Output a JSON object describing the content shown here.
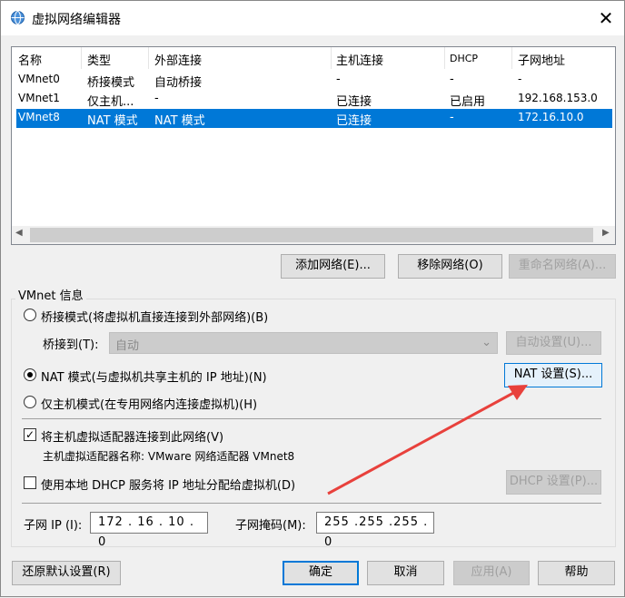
{
  "window": {
    "title": "虚拟网络编辑器",
    "close": "✕"
  },
  "table": {
    "headers": [
      "名称",
      "类型",
      "外部连接",
      "主机连接",
      "DHCP",
      "子网地址"
    ],
    "rows": [
      [
        "VMnet0",
        "桥接模式",
        "自动桥接",
        "-",
        "-",
        "-"
      ],
      [
        "VMnet1",
        "仅主机...",
        "-",
        "已连接",
        "已启用",
        "192.168.153.0"
      ],
      [
        "VMnet8",
        "NAT 模式",
        "NAT 模式",
        "已连接",
        "-",
        "172.16.10.0"
      ]
    ],
    "selected_index": 2
  },
  "net_buttons": {
    "add": "添加网络(E)...",
    "remove": "移除网络(O)",
    "rename": "重命名网络(A)..."
  },
  "info": {
    "group_label": "VMnet 信息",
    "bridged": "桥接模式(将虚拟机直接连接到外部网络)(B)",
    "bridge_to_label": "桥接到(T):",
    "bridge_to_value": "自动",
    "auto_settings": "自动设置(U)...",
    "nat": "NAT 模式(与虚拟机共享主机的 IP 地址)(N)",
    "nat_settings": "NAT 设置(S)...",
    "host_only": "仅主机模式(在专用网络内连接虚拟机)(H)",
    "connect_adapter": "将主机虚拟适配器连接到此网络(V)",
    "connect_adapter_checked": true,
    "adapter_name": "主机虚拟适配器名称: VMware 网络适配器 VMnet8",
    "use_dhcp": "使用本地 DHCP 服务将 IP 地址分配给虚拟机(D)",
    "use_dhcp_checked": false,
    "dhcp_settings": "DHCP 设置(P)...",
    "subnet_ip_label": "子网 IP (I):",
    "subnet_ip": "172 . 16 . 10 . 0",
    "subnet_mask_label": "子网掩码(M):",
    "subnet_mask": "255 .255 .255 . 0"
  },
  "footer": {
    "restore": "还原默认设置(R)",
    "ok": "确定",
    "cancel": "取消",
    "apply": "应用(A)",
    "help": "帮助"
  },
  "annotation_color": "#e8413c"
}
